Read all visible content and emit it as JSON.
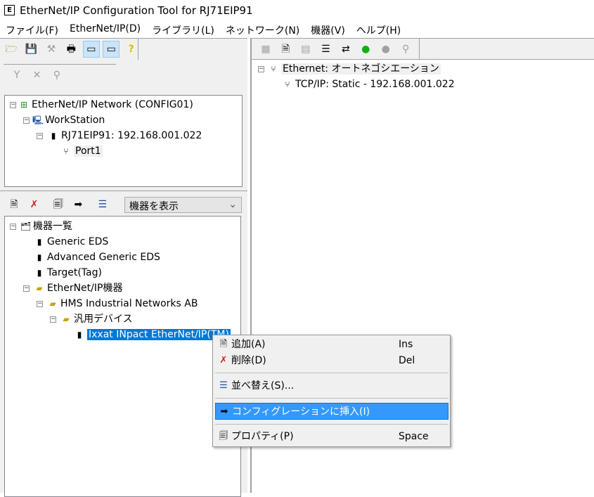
{
  "window": {
    "title": "EtherNet/IP Configuration Tool for RJ71EIP91",
    "icon_letter": "E"
  },
  "menubar": [
    "ファイル(F)",
    "EtherNet/IP(D)",
    "ライブラリ(L)",
    "ネットワーク(N)",
    "機器(V)",
    "ヘルプ(H)"
  ],
  "network_tree": {
    "root": "EtherNet/IP Network (CONFIG01)",
    "workstation": "WorkStation",
    "module": "RJ71EIP91: 192.168.001.022",
    "port": "Port1"
  },
  "device_toolbar": {
    "view_select": "機器を表示"
  },
  "device_tree": {
    "root": "機器一覧",
    "items": [
      "Generic EDS",
      "Advanced Generic EDS",
      "Target(Tag)"
    ],
    "ethernetip": "EtherNet/IP機器",
    "vendor": "HMS Industrial Networks AB",
    "category": "汎用デバイス",
    "device": "Ixxat INpact EtherNet/IP(TM)"
  },
  "port_tree": {
    "ethernet": "Ethernet: オートネゴシエーション",
    "tcpip": "TCP/IP:  Static - 192.168.001.022"
  },
  "context_menu": {
    "add": {
      "label": "追加(A)",
      "shortcut": "Ins"
    },
    "delete": {
      "label": "削除(D)",
      "shortcut": "Del"
    },
    "sort": {
      "label": "並べ替え(S)..."
    },
    "insert": {
      "label": "コンフィグレーションに挿入(I)"
    },
    "properties": {
      "label": "プロパティ(P)",
      "shortcut": "Space"
    }
  },
  "colors": {
    "selection": "#0078d7",
    "menu_highlight": "#3399ff"
  }
}
